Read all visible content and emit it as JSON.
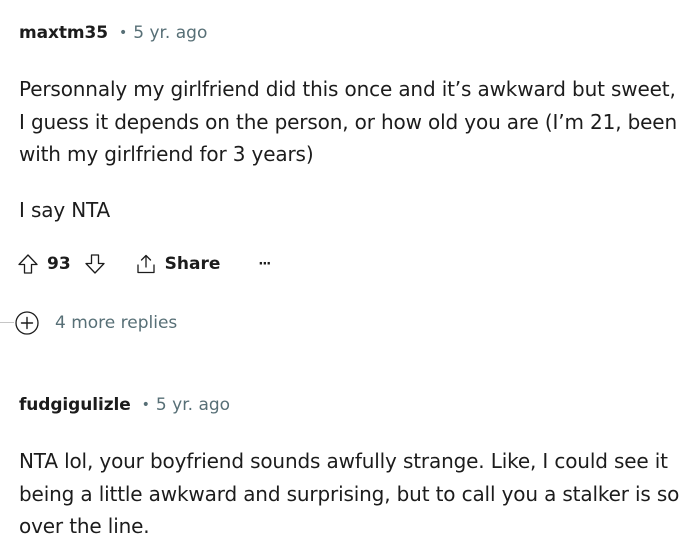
{
  "comments": [
    {
      "author": "maxtm35",
      "separator": "•",
      "time": "5 yr. ago",
      "paragraphs": [
        "Personnaly my girlfriend did this once and it’s awkward but sweet,",
        "I guess it depends on the person, or how old you are (I’m 21, been",
        "with my girlfriend for 3 years)"
      ],
      "paragraph2": "I say NTA",
      "vote_count": "93",
      "share_label": "Share",
      "more_label": "···",
      "more_replies_label": "4 more replies",
      "expand_symbol": "+"
    },
    {
      "author": "fudgigulizle",
      "separator": "•",
      "time": "5 yr. ago",
      "paragraphs": [
        "NTA lol, your boyfriend sounds awfully strange. Like, I could see it",
        "being a little awkward and surprising, but to call you a stalker is so",
        "over the line."
      ]
    }
  ],
  "icons": {
    "upvote": "upvote-arrow-icon",
    "downvote": "downvote-arrow-icon",
    "share": "share-icon",
    "overflow": "overflow-menu-icon",
    "expand": "expand-plus-icon"
  },
  "colors": {
    "text": "#1c1c1c",
    "meta": "#576f76",
    "thread_line": "#c6c6c6"
  }
}
